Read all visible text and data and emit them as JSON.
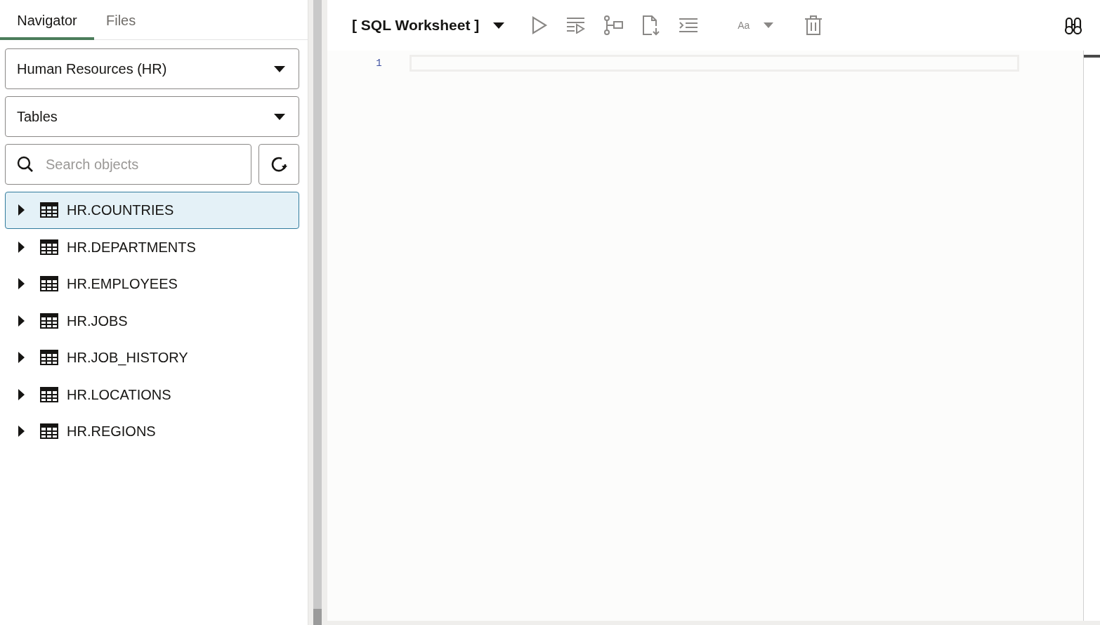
{
  "tabs": [
    {
      "label": "Navigator",
      "selected": true
    },
    {
      "label": "Files",
      "selected": false
    }
  ],
  "schema_select": {
    "value": "Human Resources (HR)"
  },
  "object_type_select": {
    "value": "Tables"
  },
  "search": {
    "placeholder": "Search objects"
  },
  "tree": [
    {
      "label": "HR.COUNTRIES",
      "selected": true,
      "expanded": false
    },
    {
      "label": "HR.DEPARTMENTS",
      "selected": false,
      "expanded": false
    },
    {
      "label": "HR.EMPLOYEES",
      "selected": false,
      "expanded": false
    },
    {
      "label": "HR.JOBS",
      "selected": false,
      "expanded": false
    },
    {
      "label": "HR.JOB_HISTORY",
      "selected": false,
      "expanded": false
    },
    {
      "label": "HR.LOCATIONS",
      "selected": false,
      "expanded": false
    },
    {
      "label": "HR.REGIONS",
      "selected": false,
      "expanded": false
    }
  ],
  "worksheet": {
    "title": "[ SQL Worksheet ]",
    "font_button": "Aa",
    "line_numbers": [
      "1"
    ]
  }
}
